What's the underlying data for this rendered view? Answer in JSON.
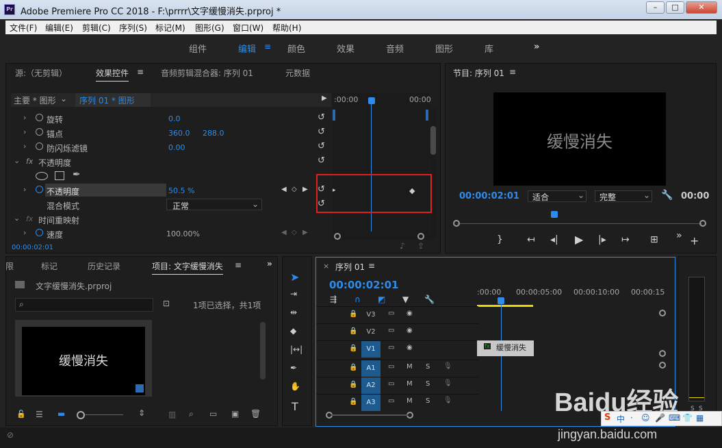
{
  "window": {
    "title": "Adobe Premiere Pro CC 2018 - F:\\prrrr\\文字缓慢消失.prproj *",
    "logo": "Pr"
  },
  "menu": [
    "文件(F)",
    "编辑(E)",
    "剪辑(C)",
    "序列(S)",
    "标记(M)",
    "图形(G)",
    "窗口(W)",
    "帮助(H)"
  ],
  "workspaces": {
    "items": [
      "组件",
      "编辑",
      "颜色",
      "效果",
      "音频",
      "图形",
      "库"
    ],
    "active": "编辑",
    "more": "»"
  },
  "effect_panel": {
    "tabs": [
      "源:（无剪辑）",
      "效果控件",
      "音频剪辑混合器: 序列 01",
      "元数据"
    ],
    "active_tab": "效果控件",
    "master": "主要 * 图形",
    "seq": "序列 01 * 图形",
    "time_start": ":00:00",
    "time_end": "00:00",
    "rows": [
      {
        "label": "旋转",
        "v1": "0.0"
      },
      {
        "label": "锚点",
        "v1": "360.0",
        "v2": "288.0"
      },
      {
        "label": "防闪烁滤镜",
        "v1": "0.00"
      },
      {
        "label": "不透明度",
        "fx": "fx"
      },
      {
        "label": "不透明度",
        "v1": "50.5 %"
      },
      {
        "label": "混合模式",
        "select": "正常"
      },
      {
        "label": "时间重映射",
        "fx": "fx"
      },
      {
        "label": "速度",
        "v1": "100.00%"
      }
    ],
    "timecode": "00:00:02:01"
  },
  "program": {
    "title": "节目: 序列 01",
    "preview_text": "缓慢消失",
    "timecode": "00:00:02:01",
    "fit": "适合",
    "quality": "完整",
    "end_time": "00:00"
  },
  "project": {
    "tabs": [
      "限",
      "标记",
      "历史记录",
      "项目: 文字缓慢消失"
    ],
    "active_tab": "项目: 文字缓慢消失",
    "file": "文字缓慢消失.prproj",
    "status": "1项已选择，共1项",
    "thumb_text": "缓慢消失",
    "search_placeholder": ""
  },
  "sequence": {
    "tab": "序列 01",
    "timecode": "00:00:02:01",
    "ruler": [
      ":00:00",
      "00:00:05:00",
      "00:00:10:00",
      "00:00:15"
    ],
    "video_tracks": [
      "V3",
      "V2",
      "V1"
    ],
    "audio_tracks": [
      "A1",
      "A2",
      "A3"
    ],
    "clip": "缓慢消失",
    "clip_fx": "fx",
    "m": "M",
    "s": "S"
  },
  "meter": {
    "labels": [
      "S",
      "S"
    ]
  },
  "watermark": {
    "brand": "Baidu经验",
    "url": "jingyan.baidu.com"
  },
  "colors": {
    "accent": "#2d8ceb",
    "track_on": "#1e5a8e",
    "clip": "#c8c8c8",
    "highlight": "#e02020",
    "work_area": "#e8d800"
  }
}
